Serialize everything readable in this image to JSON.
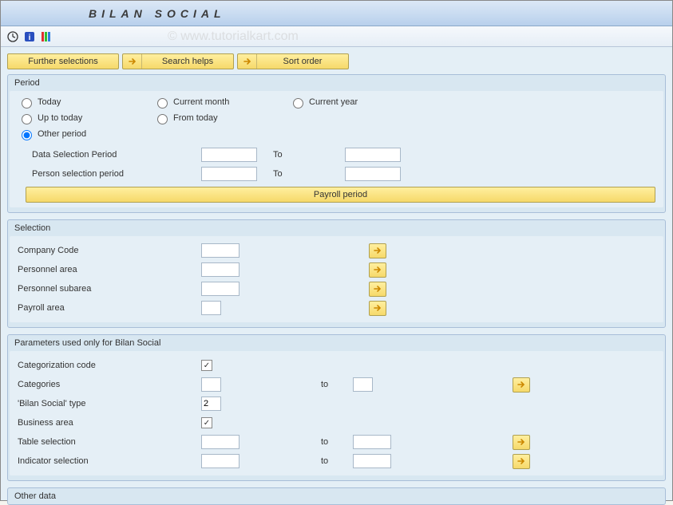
{
  "title": "BILAN SOCIAL",
  "watermark": "© www.tutorialkart.com",
  "buttons": {
    "further_selections": "Further selections",
    "search_helps": "Search helps",
    "sort_order": "Sort order",
    "payroll_period": "Payroll period"
  },
  "panels": {
    "period": {
      "title": "Period",
      "today": "Today",
      "current_month": "Current month",
      "current_year": "Current year",
      "up_to_today": "Up to today",
      "from_today": "From today",
      "other_period": "Other period",
      "data_selection_period": "Data Selection Period",
      "person_selection_period": "Person selection period",
      "to": "To"
    },
    "selection": {
      "title": "Selection",
      "company_code": "Company Code",
      "personnel_area": "Personnel area",
      "personnel_subarea": "Personnel subarea",
      "payroll_area": "Payroll area"
    },
    "params": {
      "title": "Parameters used only for Bilan Social",
      "categorization_code": "Categorization code",
      "categories": "Categories",
      "bilan_social_type": "'Bilan Social' type",
      "bilan_social_type_value": "2",
      "business_area": "Business area",
      "table_selection": "Table selection",
      "indicator_selection": "Indicator selection",
      "to": "to"
    },
    "other_data": {
      "title": "Other data"
    }
  },
  "icons": {
    "execute": "execute",
    "info": "info",
    "variant": "variant",
    "arrow_right": "arrow-right"
  }
}
